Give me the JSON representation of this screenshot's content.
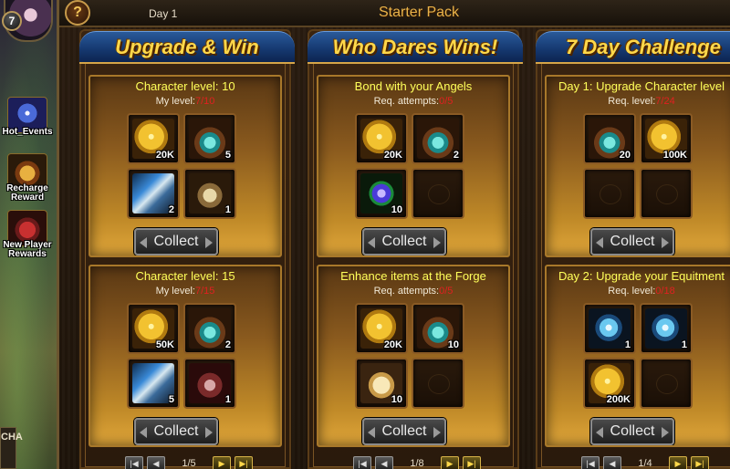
{
  "player": {
    "level": "7"
  },
  "side_menu": [
    {
      "id": "hot",
      "label": "Hot_Events",
      "icon": "hot-events-icon"
    },
    {
      "id": "recharge",
      "label": "Recharge Reward",
      "icon": "recharge-reward-icon"
    },
    {
      "id": "newplayer",
      "label": "New Player Rewards",
      "icon": "new-player-rewards-icon"
    }
  ],
  "chat_tab": {
    "label": "CHA"
  },
  "window": {
    "day": "Day 1",
    "title": "Starter Pack",
    "help": "?"
  },
  "panels": [
    {
      "banner": "Upgrade & Win",
      "sections": [
        {
          "title": "Character level: 10",
          "req_label": "My level:",
          "req_value": "7/10",
          "items": [
            {
              "icon": "gold",
              "qty": "20K"
            },
            {
              "icon": "potion",
              "qty": "5"
            },
            {
              "icon": "drill",
              "qty": "2"
            },
            {
              "icon": "chest",
              "qty": "1"
            }
          ],
          "button": "Collect"
        },
        {
          "title": "Character level: 15",
          "req_label": "My level:",
          "req_value": "7/15",
          "items": [
            {
              "icon": "gold",
              "qty": "50K"
            },
            {
              "icon": "potion",
              "qty": "2"
            },
            {
              "icon": "drill",
              "qty": "5"
            },
            {
              "icon": "chest-red",
              "qty": "1"
            }
          ],
          "button": "Collect"
        }
      ],
      "page": "1/5"
    },
    {
      "banner": "Who Dares Wins!",
      "sections": [
        {
          "title": "Bond with your Angels",
          "req_label": "Req. attempts:",
          "req_value": "0/5",
          "items": [
            {
              "icon": "gold",
              "qty": "20K"
            },
            {
              "icon": "potion",
              "qty": "2"
            },
            {
              "icon": "gem",
              "qty": "10"
            },
            {
              "icon": "",
              "qty": ""
            }
          ],
          "button": "Collect"
        },
        {
          "title": "Enhance items at the Forge",
          "req_label": "Req. attempts:",
          "req_value": "0/5",
          "items": [
            {
              "icon": "gold",
              "qty": "20K"
            },
            {
              "icon": "potion",
              "qty": "10"
            },
            {
              "icon": "scroll",
              "qty": "10"
            },
            {
              "icon": "",
              "qty": ""
            }
          ],
          "button": "Collect"
        }
      ],
      "page": "1/8"
    },
    {
      "banner": "7 Day Challenge",
      "sections": [
        {
          "title": "Day 1: Upgrade Character level",
          "req_label": "Req. level:",
          "req_value": "7/24",
          "items": [
            {
              "icon": "potion",
              "qty": "20"
            },
            {
              "icon": "gold",
              "qty": "100K"
            },
            {
              "icon": "",
              "qty": ""
            },
            {
              "icon": "",
              "qty": ""
            }
          ],
          "button": "Collect"
        },
        {
          "title": "Day 2: Upgrade your Equitment",
          "req_label": "Req. level:",
          "req_value": "0/18",
          "items": [
            {
              "icon": "crystal",
              "qty": "1"
            },
            {
              "icon": "crystal",
              "qty": "1"
            },
            {
              "icon": "gold",
              "qty": "200K"
            },
            {
              "icon": "",
              "qty": ""
            }
          ],
          "button": "Collect"
        }
      ],
      "page": "1/4"
    }
  ]
}
